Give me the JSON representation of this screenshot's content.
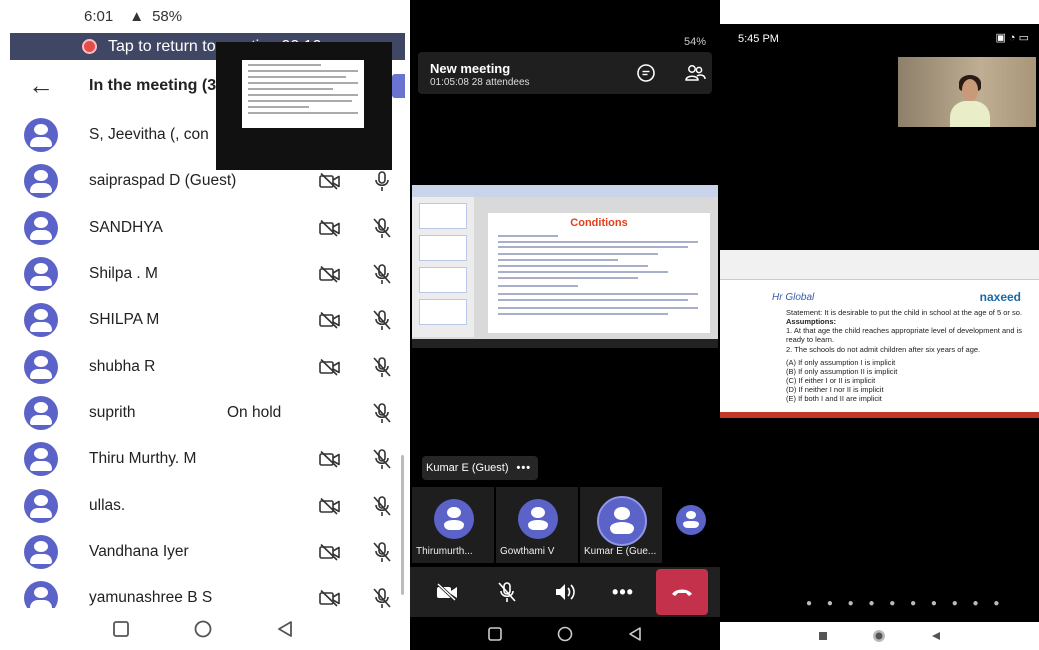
{
  "panel1": {
    "status_time": "6:01",
    "status_battery": "58%",
    "return_text": "Tap to return to meeting 00:10",
    "title": "In the meeting (3",
    "participants": [
      {
        "name": "S, Jeevitha (, con",
        "status": "",
        "camera": "off",
        "mic": "hidden"
      },
      {
        "name": "saipraspad D (Guest)",
        "status": "",
        "camera": "off",
        "mic": "on"
      },
      {
        "name": "SANDHYA",
        "status": "",
        "camera": "off",
        "mic": "off"
      },
      {
        "name": "Shilpa . M",
        "status": "",
        "camera": "off",
        "mic": "off"
      },
      {
        "name": "SHILPA M",
        "status": "",
        "camera": "off",
        "mic": "off"
      },
      {
        "name": "shubha R",
        "status": "",
        "camera": "off",
        "mic": "off"
      },
      {
        "name": "suprith",
        "status": "On hold",
        "camera": "hidden",
        "mic": "off"
      },
      {
        "name": "Thiru Murthy. M",
        "status": "",
        "camera": "off",
        "mic": "off"
      },
      {
        "name": "ullas.",
        "status": "",
        "camera": "off",
        "mic": "off"
      },
      {
        "name": "Vandhana Iyer",
        "status": "",
        "camera": "off",
        "mic": "off"
      },
      {
        "name": "yamunashree B S",
        "status": "",
        "camera": "off",
        "mic": "off"
      }
    ]
  },
  "panel2": {
    "battery": "54%",
    "meeting_title": "New meeting",
    "meeting_sub": "01:05:08  28 attendees",
    "slide_title": "Conditions",
    "presenter_pill": "Kumar E (Guest)",
    "tiles": [
      {
        "label": "Thirumurth..."
      },
      {
        "label": "Gowthami V"
      },
      {
        "label": "Kumar E (Gue..."
      },
      {
        "label": ""
      }
    ]
  },
  "panel3": {
    "status_time": "5:45 PM",
    "logo_left": "Hr Global",
    "logo_right": "naxeed",
    "slide_statement": "Statement: It is desirable to put the child in school  at the age of 5 or so.",
    "slide_assumptions_title": "Assumptions:",
    "slide_assumption_1": "1. At that age the child reaches appropriate level of development and is ready to learn.",
    "slide_assumption_2": "2. The schools do not admit children after six years of age.",
    "slide_options": [
      "(A) If only assumption I is implicit",
      "(B) If only assumption II is implicit",
      "(C) If either I or II is implicit",
      "(D) If neither I nor II is implicit",
      "(E) If both I and II are implicit"
    ]
  },
  "colors": {
    "teams_purple": "#5b63c8",
    "end_call_red": "#c4314b",
    "return_bar": "#404765"
  }
}
